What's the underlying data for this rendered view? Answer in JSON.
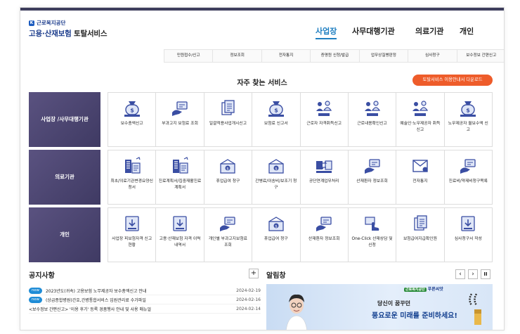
{
  "header": {
    "org": "근로복지공단",
    "service_a": "고용·산재보험",
    "service_b": "토탈서비스"
  },
  "main_nav": [
    {
      "label": "사업장",
      "active": true
    },
    {
      "label": "사무대행기관",
      "active": false
    },
    {
      "label": "의료기관",
      "active": false
    },
    {
      "label": "개인",
      "active": false
    }
  ],
  "sub_nav": [
    "민원접수/신고",
    "정보조회",
    "전자통지",
    "증명원 신청/발급",
    "업무상질병판정",
    "심사청구",
    "보수정보 간편신고"
  ],
  "freq": {
    "title": "자주 찾는 서비스",
    "download_button": "토탈서비스 이용안내서 다운로드"
  },
  "rows": [
    {
      "category": [
        "사업장 /",
        "사무대행기관"
      ],
      "items": [
        {
          "label": "보수총액신고",
          "icon": "money-bag-icon"
        },
        {
          "label": "부과고지 보험료 조회",
          "icon": "hand-card-icon"
        },
        {
          "label": "일괄적용사업개시신고",
          "icon": "documents-icon"
        },
        {
          "label": "보험료 신고서",
          "icon": "money-bag-icon"
        },
        {
          "label": "근로자 자격취득신고",
          "icon": "people-icon"
        },
        {
          "label": "근로내용확인신고",
          "icon": "people-icon"
        },
        {
          "label": "예술인·노무제공자 취득신고",
          "icon": "people-icon"
        },
        {
          "label": "노무제공자 월보수액 신고",
          "icon": "money-bag-icon"
        }
      ]
    },
    {
      "category": [
        "의료기관"
      ],
      "items": [
        {
          "label": "최초/의료기관변경요양신청서",
          "icon": "building-form-icon"
        },
        {
          "label": "진료계획서/집중재활진료계획서",
          "icon": "building-form-icon"
        },
        {
          "label": "휴업급여 청구",
          "icon": "money-box-icon"
        },
        {
          "label": "간병료/이송비/보조기 청구",
          "icon": "money-box-icon"
        },
        {
          "label": "공단연계업무처리",
          "icon": "exchange-icon"
        },
        {
          "label": "산재환자 정보조회",
          "icon": "hand-card-icon"
        },
        {
          "label": "전자통지",
          "icon": "envelope-icon"
        },
        {
          "label": "진료비/약제비청구목록",
          "icon": "hand-card-icon"
        }
      ]
    },
    {
      "category": [
        "개인"
      ],
      "items": [
        {
          "label": "사업장 피보험자격 신고현황",
          "icon": "download-doc-icon"
        },
        {
          "label": "고용·산재보험 자격 이력 내역서",
          "icon": "download-doc-icon"
        },
        {
          "label": "개인별 부과고지보험료 조회",
          "icon": "hand-card-icon"
        },
        {
          "label": "휴업급여 청구",
          "icon": "money-box-icon"
        },
        {
          "label": "산재환자 정보조회",
          "icon": "hand-card-icon"
        },
        {
          "label": "One-Click 산재상담 및 신청",
          "icon": "touch-icon"
        },
        {
          "label": "보험급여지급확인원",
          "icon": "documents-icon"
        },
        {
          "label": "심사청구서 작성",
          "icon": "download-doc-icon"
        }
      ]
    }
  ],
  "notices": {
    "title": "공지사항",
    "items": [
      {
        "badge": "new",
        "text": "2023년도(귀속) 고용보험 노무제공자 보수총액신고 안내",
        "date": "2024-02-19"
      },
      {
        "badge": "new",
        "text": "(상급종합병원)간호,간병통합서비스 입원관리료 수가파일",
        "date": "2024-02-16"
      },
      {
        "badge": "",
        "text": "<보수정보 간편신고> '이용 후기' 등록 경품행사 안내 및 사용 매뉴얼",
        "date": "2024-02-14"
      }
    ]
  },
  "alarm": {
    "title": "알림창",
    "banner": {
      "tag": "근로복지공단",
      "brand": "푸른씨앗",
      "line1": "당신이 꿈꾸던",
      "line2": "풍요로운 미래를 준비하세요!"
    }
  },
  "colors": {
    "accent": "#1f7fc1",
    "category_bg": "#4b4570",
    "download_btn": "#ee5c2a",
    "badge": "#1f8cd6"
  }
}
